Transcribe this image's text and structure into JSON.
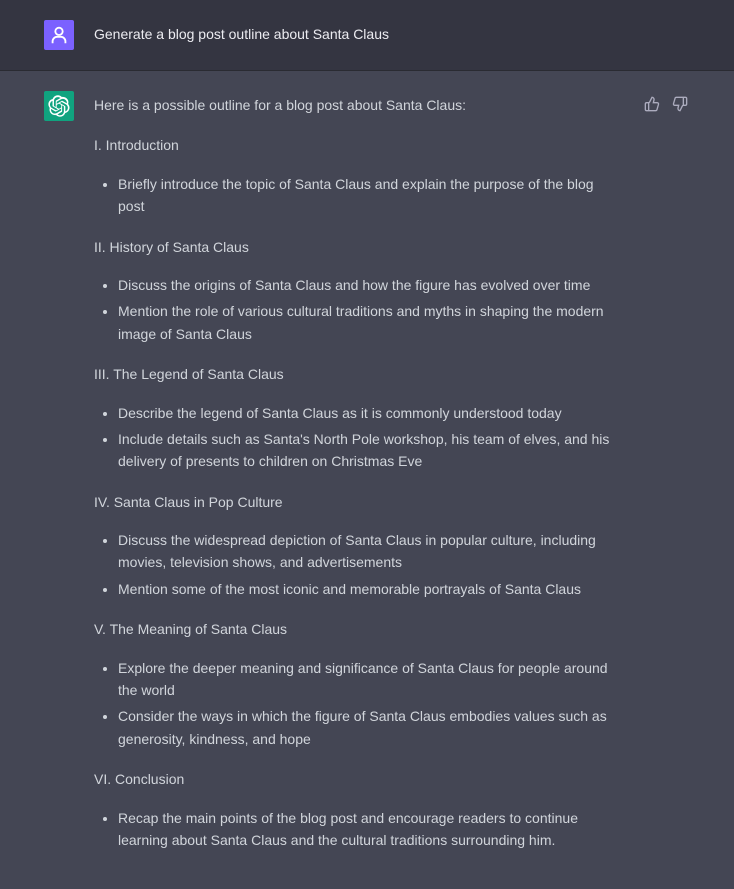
{
  "user_message": {
    "text": "Generate a blog post outline about Santa Claus"
  },
  "assistant_message": {
    "intro": "Here is a possible outline for a blog post about Santa Claus:",
    "sections": [
      {
        "header": "I. Introduction",
        "bullets": [
          "Briefly introduce the topic of Santa Claus and explain the purpose of the blog post"
        ]
      },
      {
        "header": "II. History of Santa Claus",
        "bullets": [
          "Discuss the origins of Santa Claus and how the figure has evolved over time",
          "Mention the role of various cultural traditions and myths in shaping the modern image of Santa Claus"
        ]
      },
      {
        "header": "III. The Legend of Santa Claus",
        "bullets": [
          "Describe the legend of Santa Claus as it is commonly understood today",
          "Include details such as Santa's North Pole workshop, his team of elves, and his delivery of presents to children on Christmas Eve"
        ]
      },
      {
        "header": "IV. Santa Claus in Pop Culture",
        "bullets": [
          "Discuss the widespread depiction of Santa Claus in popular culture, including movies, television shows, and advertisements",
          "Mention some of the most iconic and memorable portrayals of Santa Claus"
        ]
      },
      {
        "header": "V. The Meaning of Santa Claus",
        "bullets": [
          "Explore the deeper meaning and significance of Santa Claus for people around the world",
          "Consider the ways in which the figure of Santa Claus embodies values such as generosity, kindness, and hope"
        ]
      },
      {
        "header": "VI. Conclusion",
        "bullets": [
          "Recap the main points of the blog post and encourage readers to continue learning about Santa Claus and the cultural traditions surrounding him."
        ]
      }
    ]
  }
}
